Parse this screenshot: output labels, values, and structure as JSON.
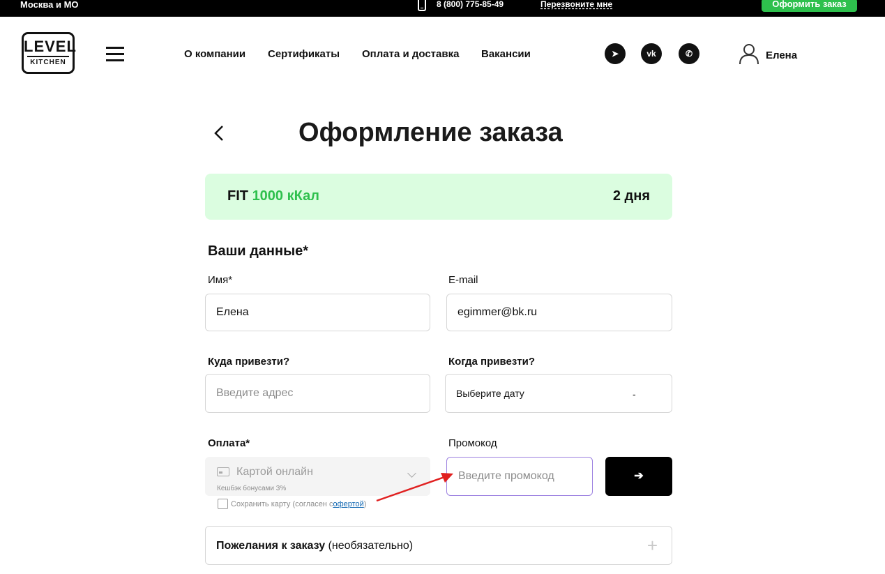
{
  "topbar": {
    "city": "Москва и МО",
    "phone_icon": "phone-icon",
    "phone": "8 (800) 775-85-49",
    "callback": "Перезвоните мне",
    "order_button": "Оформить заказ",
    "order_button_color": "#2ec04d"
  },
  "header": {
    "logo_line1": "LEVEL",
    "logo_line2": "KITCHEN",
    "nav": [
      "О компании",
      "Сертификаты",
      "Оплата и доставка",
      "Вакансии"
    ],
    "social": [
      {
        "name": "telegram-icon",
        "glyph": "➤"
      },
      {
        "name": "vk-icon",
        "glyph": "vk"
      },
      {
        "name": "whatsapp-icon",
        "glyph": "✆"
      }
    ],
    "user_name": "Елена"
  },
  "page": {
    "title": "Оформление заказа"
  },
  "plan": {
    "name": "FIT",
    "calories": "1000 кКал",
    "days": "2 дня",
    "background": "#dbfde0",
    "accent": "#2ec04d"
  },
  "form": {
    "section_title": "Ваши данные*",
    "name_label": "Имя*",
    "name_value": "Елена",
    "email_label": "E-mail",
    "email_value": "egimmer@bk.ru",
    "address_label": "Куда привезти?",
    "address_placeholder": "Введите адрес",
    "date_label": "Когда привезти?",
    "date_placeholder": "Выберите дату",
    "date_separator": "-",
    "payment_label": "Оплата*",
    "payment_value": "Картой онлайн",
    "payment_cashback": "Кешбэк бонусами 3%",
    "save_card_text": "Сохранить карту (согласен с ",
    "save_card_link": "офертой",
    "save_card_close": ")",
    "promo_label": "Промокод",
    "promo_placeholder": "Введите промокод",
    "promo_button": "➔",
    "wishes_bold": "Пожелания к заказу",
    "wishes_light": " (необязательно)",
    "wishes_plus": "+"
  },
  "annotation": {
    "arrow_color": "#e02020"
  }
}
